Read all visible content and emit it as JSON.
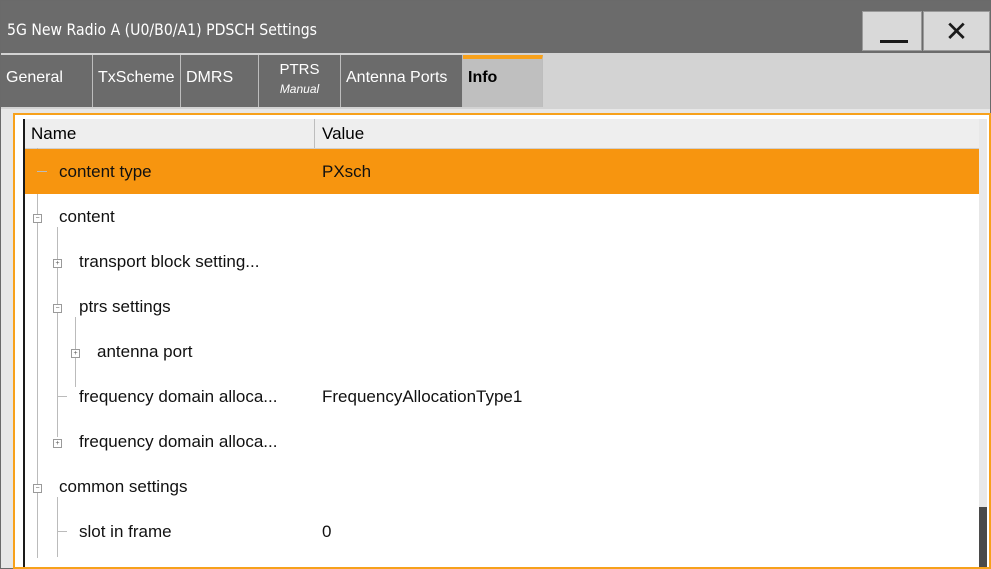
{
  "window": {
    "title": "5G New Radio A (U0/B0/A1) PDSCH Settings",
    "minimize_icon": "minimize-icon",
    "close_glyph": "✕"
  },
  "tabs": [
    {
      "label": "General"
    },
    {
      "label": "TxScheme"
    },
    {
      "label": "DMRS"
    },
    {
      "label": "PTRS",
      "sublabel": "Manual"
    },
    {
      "label": "Antenna Ports"
    },
    {
      "label": "Info",
      "active": true
    }
  ],
  "table": {
    "columns": [
      "Name",
      "Value"
    ],
    "rows": [
      {
        "name": "content type",
        "value": "PXsch",
        "selected": true
      },
      {
        "name": "content",
        "value": "",
        "expander": "collapse"
      },
      {
        "name": "transport block setting...",
        "value": "",
        "expander": "expand"
      },
      {
        "name": "ptrs settings",
        "value": "",
        "expander": "collapse"
      },
      {
        "name": "antenna port",
        "value": "",
        "expander": "expand"
      },
      {
        "name": "frequency domain alloca...",
        "value": "FrequencyAllocationType1"
      },
      {
        "name": "frequency domain alloca...",
        "value": "",
        "expander": "expand"
      },
      {
        "name": "common settings",
        "value": "",
        "expander": "collapse"
      },
      {
        "name": "slot in frame",
        "value": "0"
      }
    ]
  },
  "colors": {
    "accent": "#f7a11b",
    "selected_row": "#f7950f",
    "titlebar": "#6b6b6b"
  }
}
